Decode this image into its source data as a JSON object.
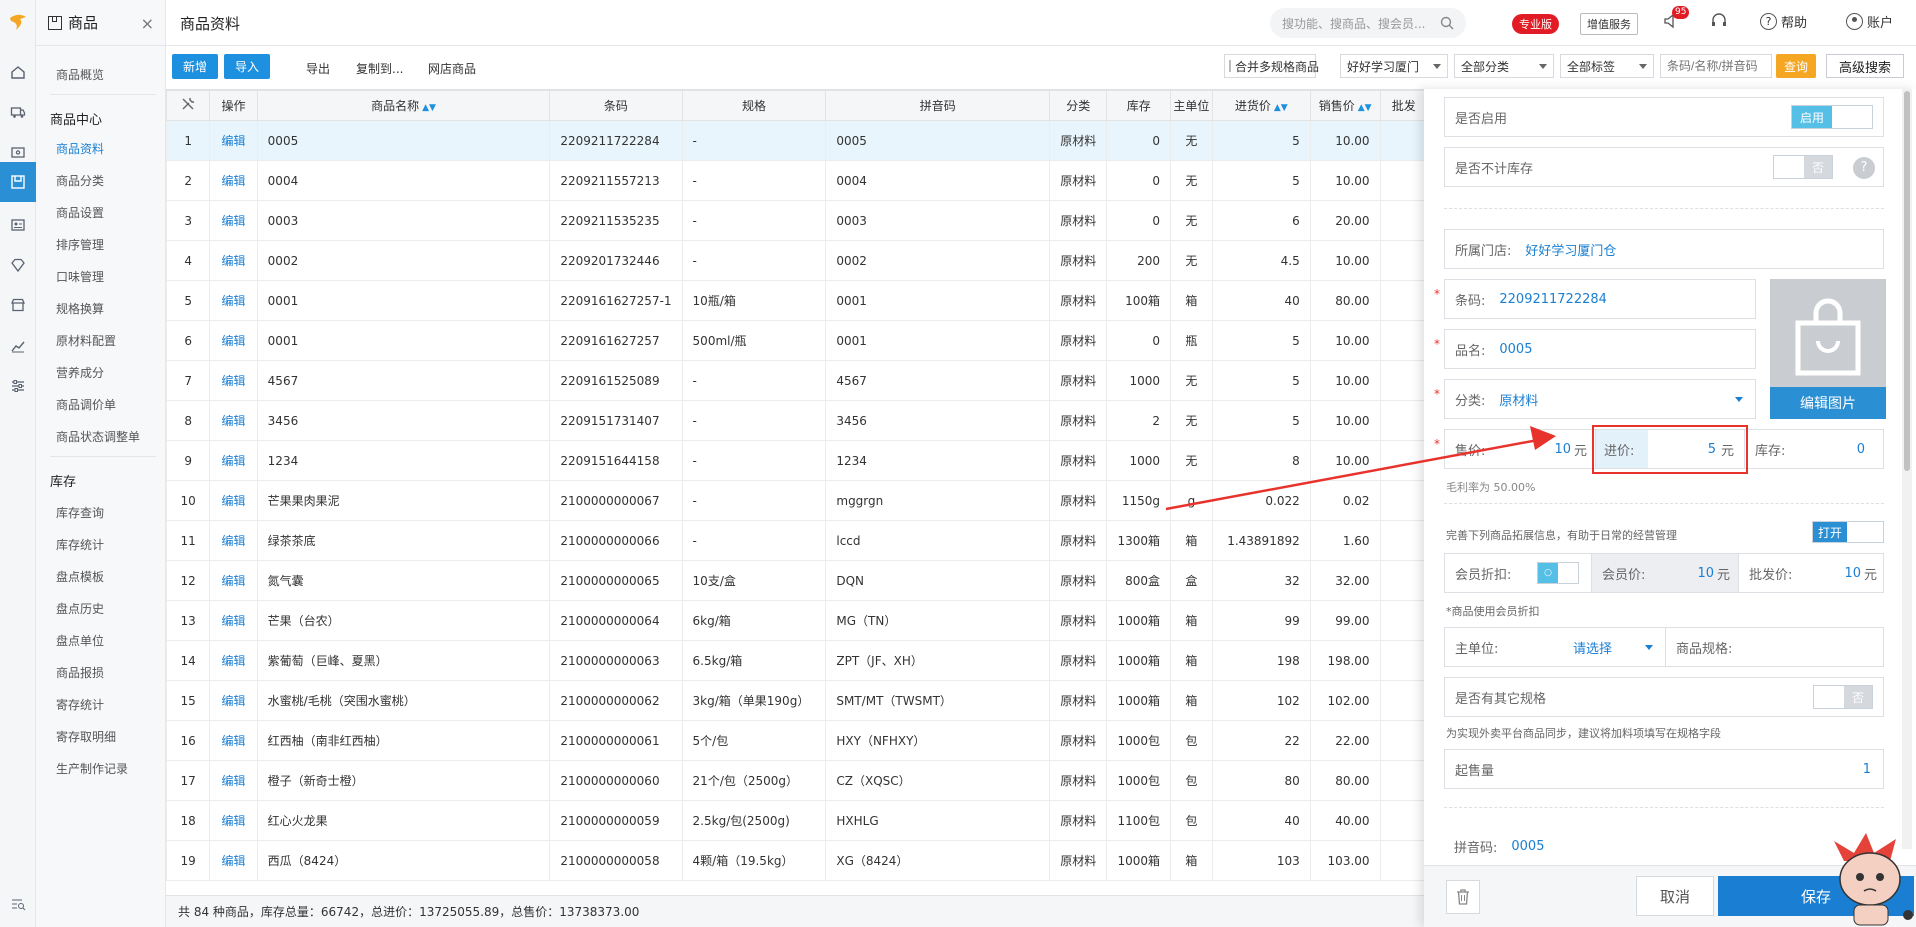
{
  "module": {
    "title": "商品"
  },
  "page": {
    "title": "商品资料"
  },
  "search": {
    "placeholder": "搜功能、搜商品、搜会员..."
  },
  "header": {
    "badge_pro": "专业版",
    "value_added": "增值服务",
    "notif_count": "95",
    "help": "帮助",
    "account": "账户"
  },
  "menu": {
    "overview": "商品概览",
    "group_center": "商品中心",
    "items": [
      "商品资料",
      "商品分类",
      "商品设置",
      "排序管理",
      "口味管理",
      "规格换算",
      "原材料配置",
      "营养成分",
      "商品调价单",
      "商品状态调整单"
    ],
    "group_stock": "库存",
    "stock_items": [
      "库存查询",
      "库存统计",
      "盘点模板",
      "盘点历史",
      "盘点单位",
      "商品报损",
      "寄存统计",
      "寄存取明细",
      "生产制作记录"
    ]
  },
  "toolbar": {
    "add": "新增",
    "import": "导入",
    "export": "导出",
    "copy": "复制到...",
    "online": "网店商品",
    "merge": "合并多规格商品",
    "store": "好好学习厦门",
    "category": "全部分类",
    "tag": "全部标签",
    "filter_placeholder": "条码/名称/拼音码",
    "query": "查询",
    "advanced": "高级搜索"
  },
  "table": {
    "headers": [
      "操作",
      "商品名称",
      "条码",
      "规格",
      "拼音码",
      "分类",
      "库存",
      "主单位",
      "进货价",
      "销售价",
      "批发"
    ],
    "edit_label": "编辑",
    "rows": [
      [
        "1",
        "0005",
        "2209211722284",
        "-",
        "0005",
        "原材料",
        "0",
        "无",
        "5",
        "10.00"
      ],
      [
        "2",
        "0004",
        "2209211557213",
        "-",
        "0004",
        "原材料",
        "0",
        "无",
        "5",
        "10.00"
      ],
      [
        "3",
        "0003",
        "2209211535235",
        "-",
        "0003",
        "原材料",
        "0",
        "无",
        "6",
        "20.00"
      ],
      [
        "4",
        "0002",
        "2209201732446",
        "-",
        "0002",
        "原材料",
        "200",
        "无",
        "4.5",
        "10.00"
      ],
      [
        "5",
        "0001",
        "2209161627257-1",
        "10瓶/箱",
        "0001",
        "原材料",
        "100箱",
        "箱",
        "40",
        "80.00"
      ],
      [
        "6",
        "0001",
        "2209161627257",
        "500ml/瓶",
        "0001",
        "原材料",
        "0",
        "瓶",
        "5",
        "10.00"
      ],
      [
        "7",
        "4567",
        "2209161525089",
        "-",
        "4567",
        "原材料",
        "1000",
        "无",
        "5",
        "10.00"
      ],
      [
        "8",
        "3456",
        "2209151731407",
        "-",
        "3456",
        "原材料",
        "2",
        "无",
        "5",
        "10.00"
      ],
      [
        "9",
        "1234",
        "2209151644158",
        "-",
        "1234",
        "原材料",
        "1000",
        "无",
        "8",
        "10.00"
      ],
      [
        "10",
        "芒果果肉果泥",
        "2100000000067",
        "-",
        "mggrgn",
        "原材料",
        "1150g",
        "g",
        "0.022",
        "0.02"
      ],
      [
        "11",
        "绿茶茶底",
        "2100000000066",
        "-",
        "lccd",
        "原材料",
        "1300箱",
        "箱",
        "1.43891892",
        "1.60"
      ],
      [
        "12",
        "氮气囊",
        "2100000000065",
        "10支/盒",
        "DQN",
        "原材料",
        "800盒",
        "盒",
        "32",
        "32.00"
      ],
      [
        "13",
        "芒果（台农）",
        "2100000000064",
        "6kg/箱",
        "MG（TN）",
        "原材料",
        "1000箱",
        "箱",
        "99",
        "99.00"
      ],
      [
        "14",
        "紫葡萄（巨峰、夏黑）",
        "2100000000063",
        "6.5kg/箱",
        "ZPT（JF、XH）",
        "原材料",
        "1000箱",
        "箱",
        "198",
        "198.00"
      ],
      [
        "15",
        "水蜜桃/毛桃（突围水蜜桃）",
        "2100000000062",
        "3kg/箱（单果190g）",
        "SMT/MT（TWSMT）",
        "原材料",
        "1000箱",
        "箱",
        "102",
        "102.00"
      ],
      [
        "16",
        "红西柚（南非红西柚）",
        "2100000000061",
        "5个/包",
        "HXY（NFHXY）",
        "原材料",
        "1000包",
        "包",
        "22",
        "22.00"
      ],
      [
        "17",
        "橙子（新奇士橙）",
        "2100000000060",
        "21个/包（2500g）",
        "CZ（XQSC）",
        "原材料",
        "1000包",
        "包",
        "80",
        "80.00"
      ],
      [
        "18",
        "红心火龙果",
        "2100000000059",
        "2.5kg/包(2500g)",
        "HXHLG",
        "原材料",
        "1100包",
        "包",
        "40",
        "40.00"
      ],
      [
        "19",
        "西瓜（8424）",
        "2100000000058",
        "4颗/箱（19.5kg）",
        "XG（8424）",
        "原材料",
        "1000箱",
        "箱",
        "103",
        "103.00"
      ]
    ]
  },
  "footer": {
    "summary": "共 84 种商品，库存总量：66742，总进价：13725055.89，总售价：13738373.00"
  },
  "panel": {
    "enabled_label": "是否启用",
    "enabled_toggle": "启用",
    "no_stock_label": "是否不计库存",
    "no_stock_toggle": "否",
    "store_label": "所属门店:",
    "store_value": "好好学习厦门仓",
    "barcode_label": "条码:",
    "barcode_value": "2209211722284",
    "name_label": "品名:",
    "name_value": "0005",
    "category_label": "分类:",
    "category_value": "原材料",
    "edit_image": "编辑图片",
    "price_label": "售价:",
    "price_value": "10",
    "unit_yuan": "元",
    "cost_label": "进价:",
    "cost_value": "5",
    "stock_label": "库存:",
    "stock_value": "0",
    "margin": "毛利率为 50.00%",
    "extend_hint": "完善下列商品拓展信息，有助于日常的经营管理",
    "extend_toggle": "打开",
    "member_discount_label": "会员折扣:",
    "member_price_label": "会员价:",
    "member_price_value": "10",
    "wholesale_label": "批发价:",
    "wholesale_value": "10",
    "member_note": "*商品使用会员折扣",
    "main_unit_label": "主单位:",
    "main_unit_value": "请选择",
    "spec_label": "商品规格:",
    "other_spec_label": "是否有其它规格",
    "other_spec_toggle": "否",
    "takeout_hint": "为实现外卖平台商品同步，建议将加料项填写在规格字段",
    "min_sale_label": "起售量",
    "min_sale_value": "1",
    "pinyin_label": "拼音码:",
    "pinyin_value": "0005",
    "cancel": "取消",
    "save": "保存"
  },
  "colors": {
    "primary": "#1e90e0",
    "highlight_red": "#e8322c",
    "query_orange": "#f5a623",
    "pro_badge": "#e21c25"
  }
}
